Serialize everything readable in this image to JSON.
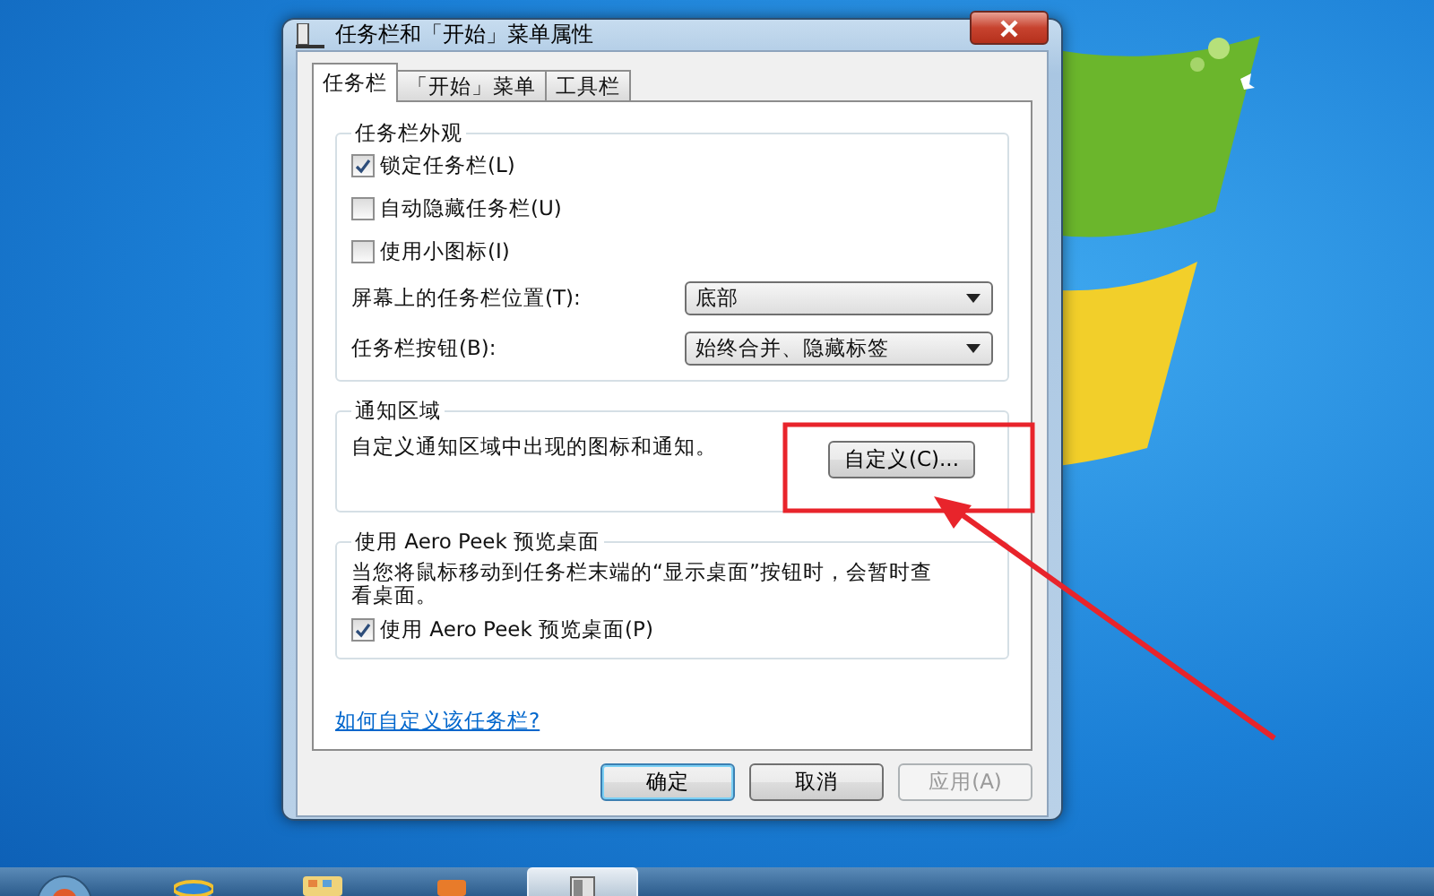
{
  "window": {
    "title": "任务栏和「开始」菜单属性"
  },
  "tabs": [
    {
      "label": "任务栏",
      "selected": true
    },
    {
      "label": "「开始」菜单",
      "selected": false
    },
    {
      "label": "工具栏",
      "selected": false
    }
  ],
  "appearance": {
    "title": "任务栏外观",
    "checkboxes": [
      {
        "label": "锁定任务栏(L)",
        "checked": true
      },
      {
        "label": "自动隐藏任务栏(U)",
        "checked": false
      },
      {
        "label": "使用小图标(I)",
        "checked": false
      }
    ],
    "selects": [
      {
        "label": "屏幕上的任务栏位置(T):",
        "value": "底部"
      },
      {
        "label": "任务栏按钮(B):",
        "value": "始终合并、隐藏标签"
      }
    ]
  },
  "notification": {
    "title": "通知区域",
    "text": "自定义通知区域中出现的图标和通知。",
    "button": "自定义(C)..."
  },
  "aero_peek": {
    "title": "使用 Aero Peek 预览桌面",
    "description": "当您将鼠标移动到任务栏末端的“显示桌面”按钮时，会暂时查看桌面。",
    "checkbox": {
      "label": "使用 Aero Peek 预览桌面(P)",
      "checked": true
    }
  },
  "help_link": "如何自定义该任务栏?",
  "buttons": [
    {
      "label": "确定",
      "default": true,
      "disabled": false
    },
    {
      "label": "取消",
      "default": false,
      "disabled": false
    },
    {
      "label": "应用(A)",
      "default": false,
      "disabled": true
    }
  ],
  "taskbar": [
    {
      "kind": "start",
      "active": false
    },
    {
      "kind": "browser",
      "active": false
    },
    {
      "kind": "folder",
      "active": false
    },
    {
      "kind": "media",
      "active": false
    },
    {
      "kind": "window",
      "active": true
    }
  ]
}
